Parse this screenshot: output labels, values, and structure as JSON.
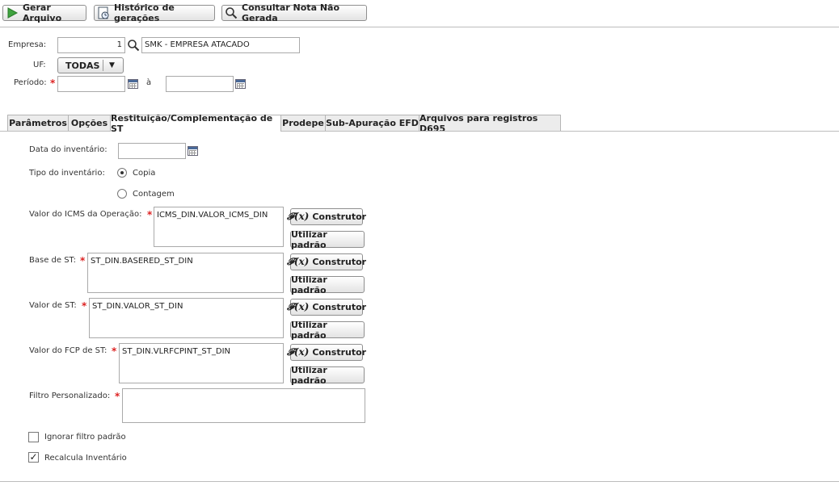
{
  "toolbar": {
    "gerar": "Gerar Arquivo",
    "historico": "Histórico de gerações",
    "consultar": "Consultar Nota Não Gerada"
  },
  "form": {
    "empresa_label": "Empresa:",
    "empresa_code": "1",
    "empresa_name": "SMK - EMPRESA ATACADO",
    "uf_label": "UF:",
    "uf_value": "TODAS",
    "periodo_label": "Período:",
    "periodo_sep": "à",
    "periodo_start": "",
    "periodo_end": ""
  },
  "tabs": [
    "Parâmetros",
    "Opções",
    "Restituição/Complementação de ST",
    "Prodepe",
    "Sub-Apuração EFD",
    "Arquivos para registros D695"
  ],
  "active_tab": 2,
  "panel": {
    "data_inventario_label": "Data do inventário:",
    "data_inventario_value": "",
    "tipo_label": "Tipo do inventário:",
    "radio_copia": "Copia",
    "radio_contagem": "Contagem",
    "selected_tipo": "Copia",
    "fields": [
      {
        "label": "Valor do ICMS da Operação:",
        "value": "ICMS_DIN.VALOR_ICMS_DIN"
      },
      {
        "label": "Base de ST:",
        "value": "ST_DIN.BASERED_ST_DIN"
      },
      {
        "label": "Valor de ST:",
        "value": "ST_DIN.VALOR_ST_DIN"
      },
      {
        "label": "Valor do FCP de ST:",
        "value": "ST_DIN.VLRFCPINT_ST_DIN"
      }
    ],
    "construtor_label": "Construtor",
    "fx_symbol": "𝓕(x)",
    "padrao_label": "Utilizar padrão",
    "filtro_label": "Filtro Personalizado:",
    "filtro_value": "",
    "ignorar_label": "Ignorar filtro padrão",
    "ignorar_checked": false,
    "recalcula_label": "Recalcula Inventário",
    "recalcula_checked": true
  }
}
